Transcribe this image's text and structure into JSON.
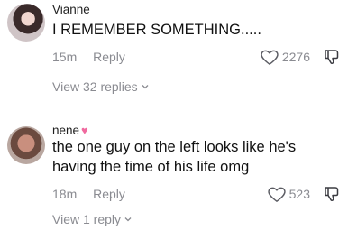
{
  "comments": [
    {
      "username": "Vianne",
      "badge": "",
      "text": "I REMEMBER SOMETHING.....",
      "time": "15m",
      "reply_label": "Reply",
      "likes": "2276",
      "view_replies": "View 32 replies"
    },
    {
      "username": "nene",
      "badge": "heart-icon",
      "text": "the one guy on the left looks like he's having the time of his life omg",
      "time": "18m",
      "reply_label": "Reply",
      "likes": "523",
      "view_replies": "View 1 reply"
    }
  ],
  "colors": {
    "text": "#111111",
    "muted": "#8a8b91",
    "badge": "#f06a9f"
  },
  "icons": [
    "heart-outline-icon",
    "thumbs-down-icon",
    "chevron-down-icon"
  ]
}
